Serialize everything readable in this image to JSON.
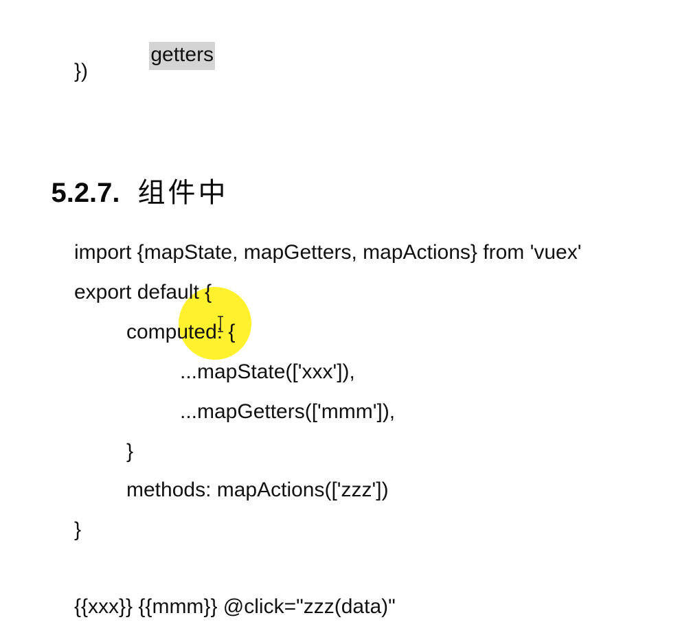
{
  "top_code": {
    "getters": "getters",
    "close": "})"
  },
  "heading": {
    "number": "5.2.7.",
    "title": "组件中"
  },
  "code": {
    "line1": "import {mapState, mapGetters, mapActions} from 'vuex'",
    "line2": "export default {",
    "line3": "computed: {",
    "line4": "...mapState(['xxx']),",
    "line5": "...mapGetters(['mmm']),",
    "line6": "}",
    "line7": "methods: mapActions(['zzz'])",
    "line8": "}",
    "line9": "{{xxx}} {{mmm}} @click=\"zzz(data)\""
  },
  "colors": {
    "text": "#111111",
    "selection_highlight": "#d4d4d4",
    "cursor_halo": "#ffee00"
  },
  "cursor": {
    "icon": "text-cursor-icon"
  }
}
